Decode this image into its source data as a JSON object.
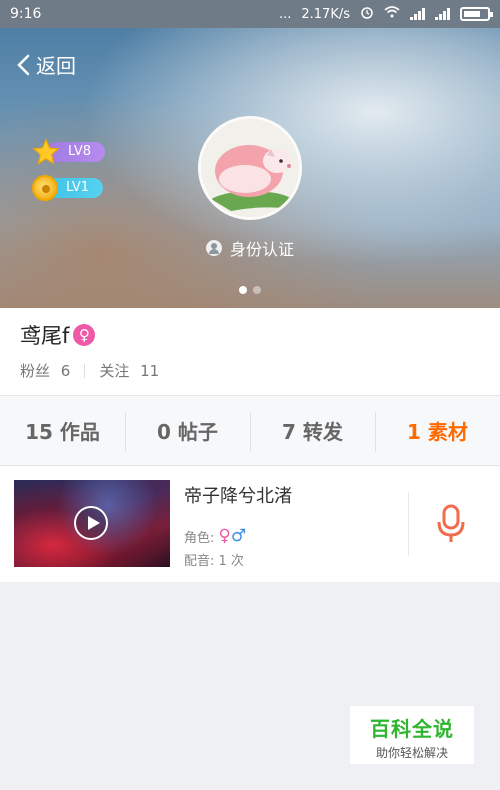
{
  "status_bar": {
    "time": "9:16",
    "dots": "...",
    "network_speed": "2.17K/s"
  },
  "header": {
    "back_label": "返回"
  },
  "levels": {
    "level1": "LV8",
    "level2": "LV1"
  },
  "verify": {
    "label": "身份认证"
  },
  "carousel": {
    "active_index": 0,
    "count": 2
  },
  "profile": {
    "name": "鸢尾f",
    "gender_symbol": "♀",
    "fans_label": "粉丝",
    "fans_count": "6",
    "following_label": "关注",
    "following_count": "11"
  },
  "tabs": [
    {
      "label": "15 作品",
      "active": false
    },
    {
      "label": "0 帖子",
      "active": false
    },
    {
      "label": "7 转发",
      "active": false
    },
    {
      "label": "1 素材",
      "active": true
    }
  ],
  "material": {
    "title": "帝子降兮北渚",
    "role_label": "角色:",
    "role_female": "♀",
    "role_male": "♂",
    "dub_text": "配音: 1 次"
  },
  "watermark": {
    "title": "百科全说",
    "subtitle": "助你轻松解决"
  },
  "colors": {
    "accent": "#ff6a00",
    "female": "#ee5aa8",
    "male": "#3a8ee6",
    "mic": "#f26b4d"
  },
  "icons": [
    "back-arrow-icon",
    "star-icon",
    "coin-icon",
    "user-icon",
    "play-icon",
    "microphone-icon",
    "battery-icon",
    "wifi-icon",
    "signal-icon",
    "alarm-icon"
  ]
}
